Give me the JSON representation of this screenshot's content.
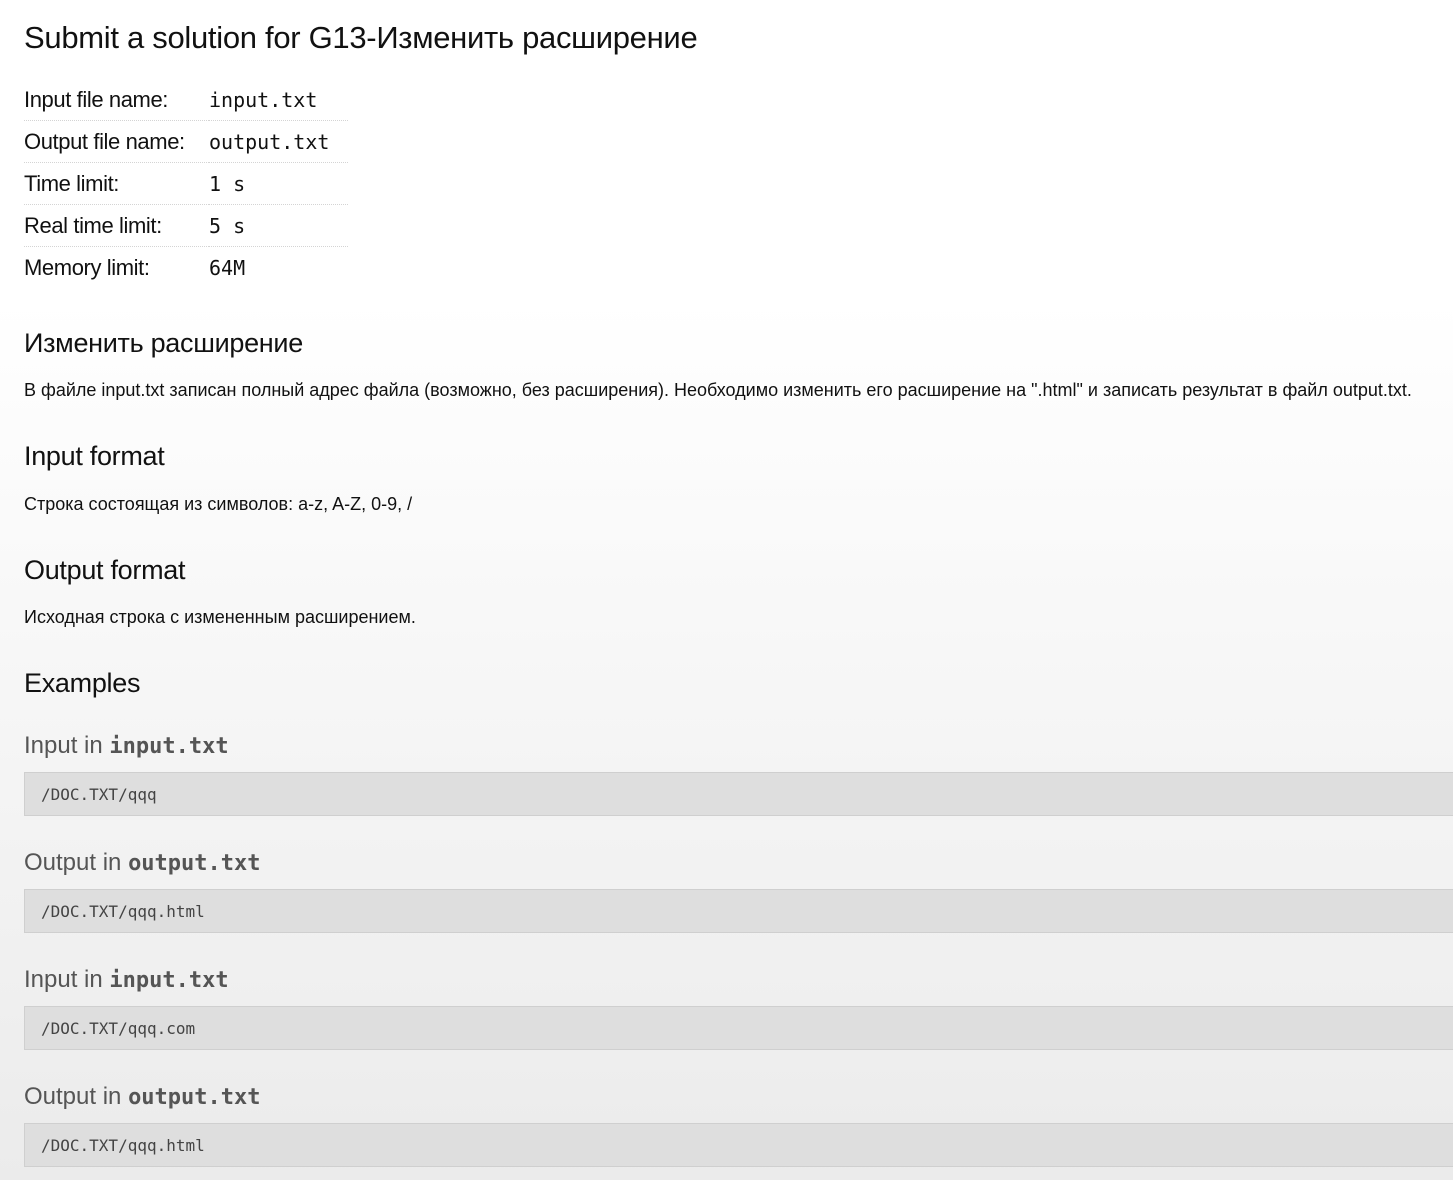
{
  "page_title": "Submit a solution for G13-Изменить расширение",
  "limits": [
    {
      "label": "Input file name:",
      "value": "input.txt"
    },
    {
      "label": "Output file name:",
      "value": "output.txt"
    },
    {
      "label": "Time limit:",
      "value": "1 s"
    },
    {
      "label": "Real time limit:",
      "value": "5 s"
    },
    {
      "label": "Memory limit:",
      "value": "64M"
    }
  ],
  "problem": {
    "title": "Изменить расширение",
    "statement": "В файле input.txt записан полный адрес файла (возможно, без расширения). Необходимо изменить его расширение на \".html\" и записать результат в файл output.txt."
  },
  "input_format": {
    "title": "Input format",
    "text": "Строка состоящая из символов: a-z, A-Z, 0-9, /"
  },
  "output_format": {
    "title": "Output format",
    "text": "Исходная строка с измененным расширением."
  },
  "examples": {
    "title": "Examples",
    "items": [
      {
        "prefix": "Input in ",
        "file": "input.txt",
        "content": "/DOC.TXT/qqq"
      },
      {
        "prefix": "Output in ",
        "file": "output.txt",
        "content": "/DOC.TXT/qqq.html"
      },
      {
        "prefix": "Input in ",
        "file": "input.txt",
        "content": "/DOC.TXT/qqq.com"
      },
      {
        "prefix": "Output in ",
        "file": "output.txt",
        "content": "/DOC.TXT/qqq.html"
      }
    ]
  }
}
